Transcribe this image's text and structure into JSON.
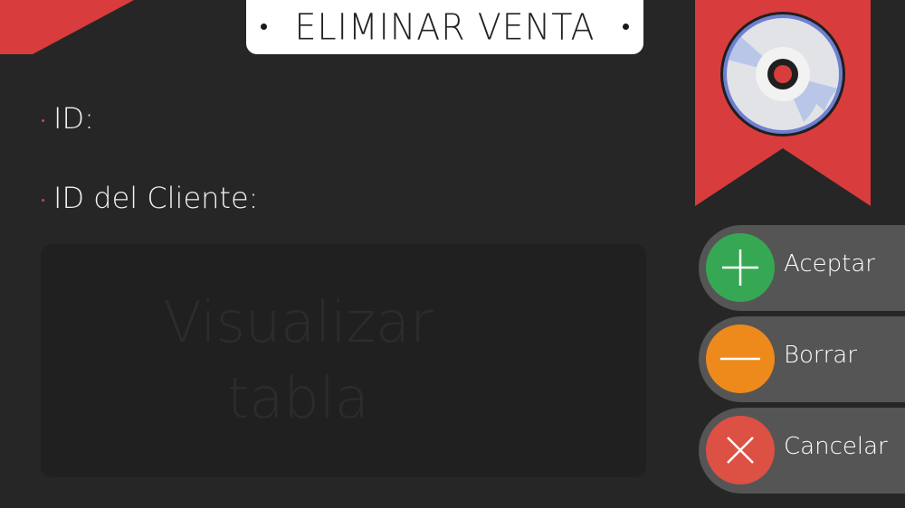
{
  "header": {
    "title": "ELIMINAR VENTA"
  },
  "fields": {
    "id_label": "ID:",
    "client_id_label": "ID del Cliente:"
  },
  "table": {
    "placeholder_line1": "Visualizar",
    "placeholder_line2": "tabla"
  },
  "actions": {
    "accept_label": "Aceptar",
    "delete_label": "Borrar",
    "cancel_label": "Cancelar"
  },
  "icons": {
    "banner": "disc-icon",
    "accept": "plus-icon",
    "delete": "minus-icon",
    "cancel": "close-icon"
  },
  "colors": {
    "background": "#262626",
    "accent_red": "#d83c3c",
    "accept_green": "#36a853",
    "delete_orange": "#ee8a1c",
    "cancel_red": "#dd5044",
    "button_gray": "#555555",
    "table_bg": "#202020"
  }
}
